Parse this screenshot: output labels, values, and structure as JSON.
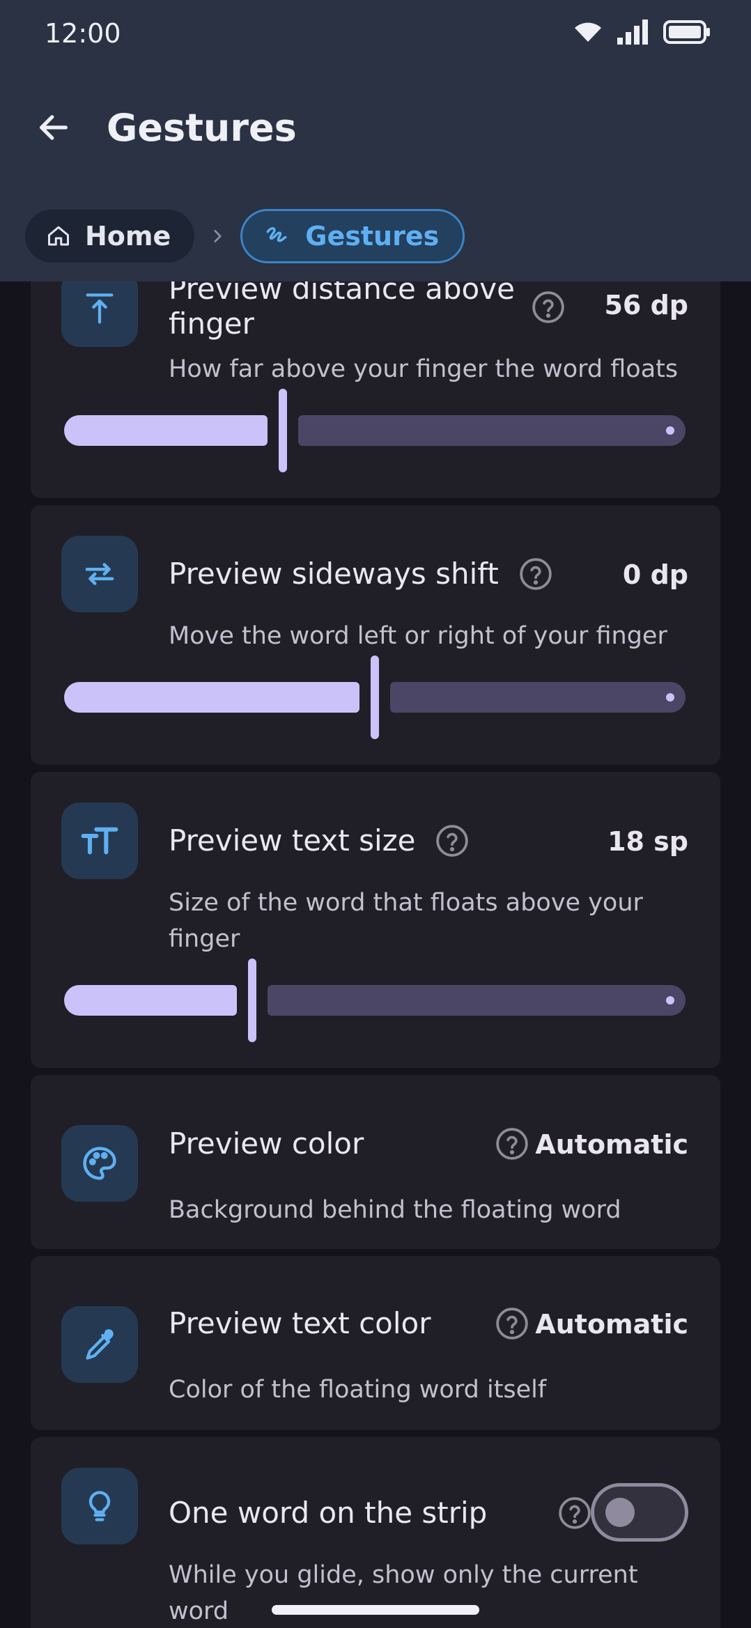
{
  "status_bar": {
    "time": "12:00"
  },
  "header": {
    "title": "Gestures"
  },
  "breadcrumb": {
    "home": "Home",
    "current": "Gestures"
  },
  "colors": {
    "header_bg": "#2a3244",
    "card_bg": "#201f27",
    "accent_blue": "#5fb0f2",
    "slider_active": "#ccc2fa",
    "slider_inactive": "#4b4566"
  },
  "settings": [
    {
      "icon": "align-top-arrow-icon",
      "title": "Preview distance above finger",
      "value": "56 dp",
      "description": "How far above your finger the word floats",
      "slider_fraction": 0.35
    },
    {
      "icon": "swap-horizontal-icon",
      "title": "Preview sideways shift",
      "value": "0 dp",
      "description": "Move the word left or right of your finger",
      "slider_fraction": 0.5
    },
    {
      "icon": "text-size-icon",
      "title": "Preview text size",
      "value": "18 sp",
      "description": "Size of the word that floats above your finger",
      "slider_fraction": 0.3
    },
    {
      "icon": "palette-icon",
      "title": "Preview color",
      "value": "Automatic",
      "description": "Background behind the floating word"
    },
    {
      "icon": "eyedropper-icon",
      "title": "Preview text color",
      "value": "Automatic",
      "description": "Color of the floating word itself"
    },
    {
      "icon": "lightbulb-icon",
      "title": "One word on the strip",
      "description": "While you glide, show only the current word",
      "toggle_on": false
    }
  ]
}
